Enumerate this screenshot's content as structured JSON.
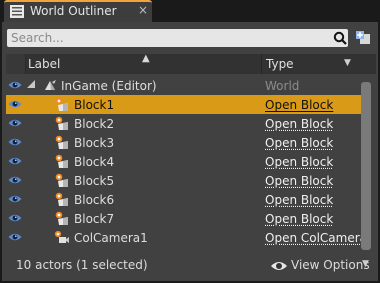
{
  "tab": {
    "title": "World Outliner",
    "close": "×"
  },
  "search": {
    "placeholder": "Search..."
  },
  "columns": {
    "label": "Label",
    "type": "Type",
    "sort_indicator": "▲",
    "options_indicator": "▼"
  },
  "rows": [
    {
      "label": "InGame (Editor)",
      "type": "World",
      "icon": "world-icon",
      "selected": false
    },
    {
      "label": "Block1",
      "type": "Open Block",
      "icon": "actor-icon",
      "selected": true
    },
    {
      "label": "Block2",
      "type": "Open Block",
      "icon": "actor-icon",
      "selected": false
    },
    {
      "label": "Block3",
      "type": "Open Block",
      "icon": "actor-icon",
      "selected": false
    },
    {
      "label": "Block4",
      "type": "Open Block",
      "icon": "actor-icon",
      "selected": false
    },
    {
      "label": "Block5",
      "type": "Open Block",
      "icon": "actor-icon",
      "selected": false
    },
    {
      "label": "Block6",
      "type": "Open Block",
      "icon": "actor-icon",
      "selected": false
    },
    {
      "label": "Block7",
      "type": "Open Block",
      "icon": "actor-icon",
      "selected": false
    },
    {
      "label": "ColCamera1",
      "type": "Open ColCamera",
      "icon": "camera-icon",
      "selected": false
    }
  ],
  "footer": {
    "status": "10 actors (1 selected)",
    "view_options": "View Options",
    "caret": "▼"
  },
  "colors": {
    "accent": "#f2a33a",
    "selection": "#d99a17",
    "panel": "#414141",
    "eye": "#4f7fc0"
  }
}
